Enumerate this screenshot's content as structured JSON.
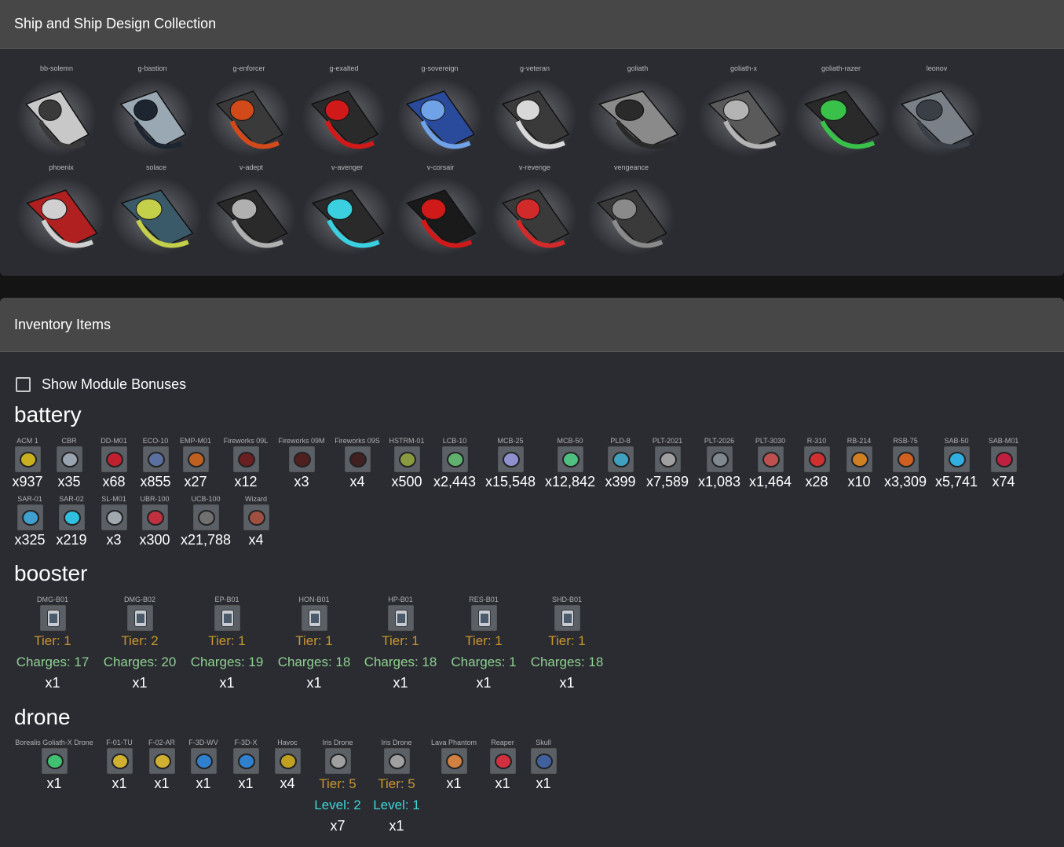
{
  "ship_panel": {
    "title": "Ship and Ship Design Collection"
  },
  "ships": [
    {
      "name": "bb-solemn",
      "color": "#c8c8c8",
      "accent": "#3a3a3a"
    },
    {
      "name": "g-bastion",
      "color": "#9aa8b4",
      "accent": "#1d2530"
    },
    {
      "name": "g-enforcer",
      "color": "#3a3a3a",
      "accent": "#d24a1a"
    },
    {
      "name": "g-exalted",
      "color": "#2a2a2a",
      "accent": "#d01a1a"
    },
    {
      "name": "g-sovereign",
      "color": "#2a4a9c",
      "accent": "#6fa2e6"
    },
    {
      "name": "g-veteran",
      "color": "#3a3a3a",
      "accent": "#d8d8d8"
    },
    {
      "name": "goliath",
      "color": "#8a8a8a",
      "accent": "#2a2a2a"
    },
    {
      "name": "goliath-x",
      "color": "#5a5a5a",
      "accent": "#b4b4b4"
    },
    {
      "name": "goliath-razer",
      "color": "#2a2a2a",
      "accent": "#39c14a"
    },
    {
      "name": "leonov",
      "color": "#7a8088",
      "accent": "#3a3e46"
    },
    {
      "name": "phoenix",
      "color": "#b02020",
      "accent": "#d0d0d0"
    },
    {
      "name": "solace",
      "color": "#3a5a6a",
      "accent": "#c4d04a"
    },
    {
      "name": "v-adept",
      "color": "#2a2a2a",
      "accent": "#b0b0b0"
    },
    {
      "name": "v-avenger",
      "color": "#2a2a2a",
      "accent": "#3ad0e0"
    },
    {
      "name": "v-corsair",
      "color": "#1a1a1a",
      "accent": "#d01a1a"
    },
    {
      "name": "v-revenge",
      "color": "#3a3a3a",
      "accent": "#d02a2a"
    },
    {
      "name": "vengeance",
      "color": "#3a3a3a",
      "accent": "#8a8a8a"
    }
  ],
  "inventory": {
    "title": "Inventory Items",
    "show_bonuses_label": "Show Module Bonuses",
    "battery": {
      "label": "battery",
      "items": [
        {
          "name": "ACM 1",
          "qty": "x937",
          "color": "#c8b020"
        },
        {
          "name": "CBR",
          "qty": "x35",
          "color": "#9aa4b0"
        },
        {
          "name": "DD-M01",
          "qty": "x68",
          "color": "#c02030"
        },
        {
          "name": "ECO-10",
          "qty": "x855",
          "color": "#5a70a0"
        },
        {
          "name": "EMP-M01",
          "qty": "x27",
          "color": "#c06020"
        },
        {
          "name": "Fireworks 09L",
          "qty": "x12",
          "color": "#6a2020"
        },
        {
          "name": "Fireworks 09M",
          "qty": "x3",
          "color": "#502020"
        },
        {
          "name": "Fireworks 09S",
          "qty": "x4",
          "color": "#402020"
        },
        {
          "name": "HSTRM-01",
          "qty": "x500",
          "color": "#8a9a40"
        },
        {
          "name": "LCB-10",
          "qty": "x2,443",
          "color": "#60b070"
        },
        {
          "name": "MCB-25",
          "qty": "x15,548",
          "color": "#9090d0"
        },
        {
          "name": "MCB-50",
          "qty": "x12,842",
          "color": "#50c080"
        },
        {
          "name": "PLD-8",
          "qty": "x399",
          "color": "#40a0c0"
        },
        {
          "name": "PLT-2021",
          "qty": "x7,589",
          "color": "#a0a0a0"
        },
        {
          "name": "PLT-2026",
          "qty": "x1,083",
          "color": "#808890"
        },
        {
          "name": "PLT-3030",
          "qty": "x1,464",
          "color": "#c05050"
        },
        {
          "name": "R-310",
          "qty": "x28",
          "color": "#d03030"
        },
        {
          "name": "RB-214",
          "qty": "x10",
          "color": "#d08020"
        },
        {
          "name": "RSB-75",
          "qty": "x3,309",
          "color": "#d06020"
        },
        {
          "name": "SAB-50",
          "qty": "x5,741",
          "color": "#30b0e0"
        },
        {
          "name": "SAB-M01",
          "qty": "x74",
          "color": "#c02040"
        },
        {
          "name": "SAR-01",
          "qty": "x325",
          "color": "#40a0d0"
        },
        {
          "name": "SAR-02",
          "qty": "x219",
          "color": "#30c0e0"
        },
        {
          "name": "SL-M01",
          "qty": "x3",
          "color": "#a0a8b0"
        },
        {
          "name": "UBR-100",
          "qty": "x300",
          "color": "#c03040"
        },
        {
          "name": "UCB-100",
          "qty": "x21,788",
          "color": "#707070"
        },
        {
          "name": "Wizard",
          "qty": "x4",
          "color": "#a05040"
        }
      ]
    },
    "booster": {
      "label": "booster",
      "items": [
        {
          "name": "DMG-B01",
          "tier": "Tier: 1",
          "charges": "Charges: 17",
          "qty": "x1"
        },
        {
          "name": "DMG-B02",
          "tier": "Tier: 2",
          "charges": "Charges: 20",
          "qty": "x1"
        },
        {
          "name": "EP-B01",
          "tier": "Tier: 1",
          "charges": "Charges: 19",
          "qty": "x1"
        },
        {
          "name": "HON-B01",
          "tier": "Tier: 1",
          "charges": "Charges: 18",
          "qty": "x1"
        },
        {
          "name": "HP-B01",
          "tier": "Tier: 1",
          "charges": "Charges: 18",
          "qty": "x1"
        },
        {
          "name": "RES-B01",
          "tier": "Tier: 1",
          "charges": "Charges: 1",
          "qty": "x1"
        },
        {
          "name": "SHD-B01",
          "tier": "Tier: 1",
          "charges": "Charges: 18",
          "qty": "x1"
        }
      ]
    },
    "drone": {
      "label": "drone",
      "items": [
        {
          "name": "Borealis Goliath-X Drone",
          "qty": "x1",
          "color": "#40c070"
        },
        {
          "name": "F-01-TU",
          "qty": "x1",
          "color": "#d0b030"
        },
        {
          "name": "F-02-AR",
          "qty": "x1",
          "color": "#d0b030"
        },
        {
          "name": "F-3D-WV",
          "qty": "x1",
          "color": "#3080d0"
        },
        {
          "name": "F-3D-X",
          "qty": "x1",
          "color": "#3080d0"
        },
        {
          "name": "Havoc",
          "qty": "x4",
          "color": "#c0a020"
        },
        {
          "name": "Iris Drone",
          "tier": "Tier: 5",
          "level": "Level: 2",
          "qty": "x7",
          "color": "#a0a0a0"
        },
        {
          "name": "Iris Drone",
          "tier": "Tier: 5",
          "level": "Level: 1",
          "qty": "x1",
          "color": "#a0a0a0"
        },
        {
          "name": "Lava Phantom",
          "qty": "x1",
          "color": "#d08040"
        },
        {
          "name": "Reaper",
          "qty": "x1",
          "color": "#d03040"
        },
        {
          "name": "Skull",
          "qty": "x1",
          "color": "#4060a0"
        }
      ]
    }
  }
}
